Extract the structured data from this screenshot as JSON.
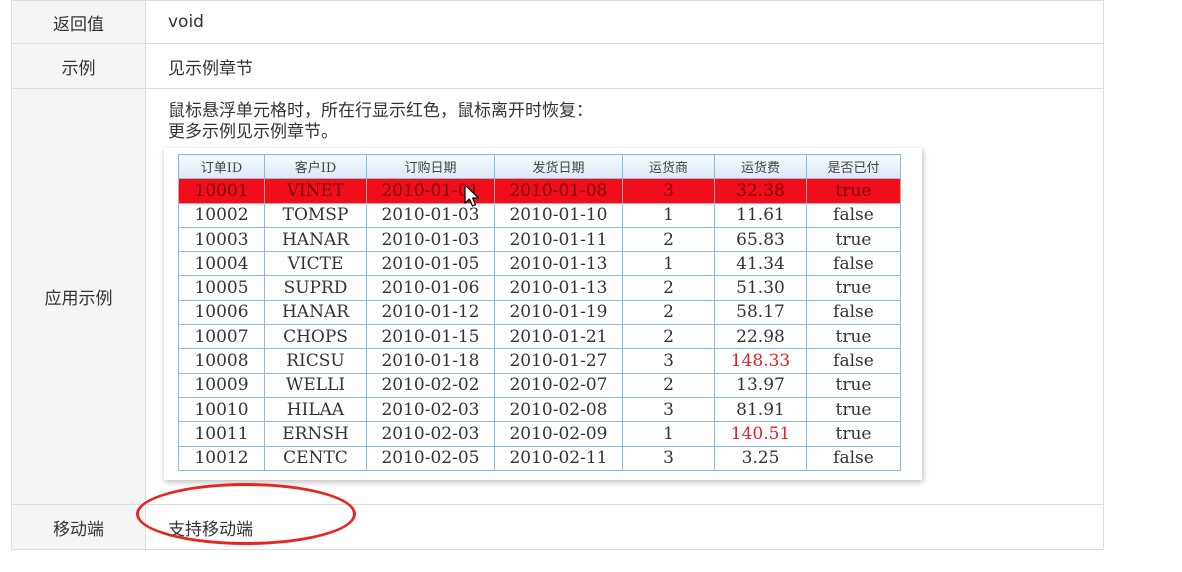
{
  "rows": {
    "return": {
      "label": "返回值",
      "value": "void"
    },
    "example": {
      "label": "示例",
      "value": "见示例章节"
    },
    "app": {
      "label": "应用示例",
      "line1": "鼠标悬浮单元格时，所在行显示红色，鼠标离开时恢复：",
      "line2": "更多示例见示例章节。"
    },
    "mobile": {
      "label": "移动端",
      "value": "支持移动端"
    }
  },
  "grid": {
    "headers": [
      "订单ID",
      "客户ID",
      "订购日期",
      "发货日期",
      "运货商",
      "运货费",
      "是否已付"
    ],
    "rows": [
      [
        "10001",
        "VINET",
        "2010-01-01",
        "2010-01-08",
        "3",
        "32.38",
        "true"
      ],
      [
        "10002",
        "TOMSP",
        "2010-01-03",
        "2010-01-10",
        "1",
        "11.61",
        "false"
      ],
      [
        "10003",
        "HANAR",
        "2010-01-03",
        "2010-01-11",
        "2",
        "65.83",
        "true"
      ],
      [
        "10004",
        "VICTE",
        "2010-01-05",
        "2010-01-13",
        "1",
        "41.34",
        "false"
      ],
      [
        "10005",
        "SUPRD",
        "2010-01-06",
        "2010-01-13",
        "2",
        "51.30",
        "true"
      ],
      [
        "10006",
        "HANAR",
        "2010-01-12",
        "2010-01-19",
        "2",
        "58.17",
        "false"
      ],
      [
        "10007",
        "CHOPS",
        "2010-01-15",
        "2010-01-21",
        "2",
        "22.98",
        "true"
      ],
      [
        "10008",
        "RICSU",
        "2010-01-18",
        "2010-01-27",
        "3",
        "148.33",
        "false"
      ],
      [
        "10009",
        "WELLI",
        "2010-02-02",
        "2010-02-07",
        "2",
        "13.97",
        "true"
      ],
      [
        "10010",
        "HILAA",
        "2010-02-03",
        "2010-02-08",
        "3",
        "81.91",
        "true"
      ],
      [
        "10011",
        "ERNSH",
        "2010-02-03",
        "2010-02-09",
        "1",
        "140.51",
        "true"
      ],
      [
        "10012",
        "CENTC",
        "2010-02-05",
        "2010-02-11",
        "3",
        "3.25",
        "false"
      ]
    ],
    "hover_row": 0,
    "highlight_threshold": 100,
    "colors": {
      "hover_bg": "#f20d1a",
      "high_value": "#e0202a",
      "grid_border": "#8bbbe0"
    }
  },
  "annotation": {
    "color": "#e8251f"
  }
}
